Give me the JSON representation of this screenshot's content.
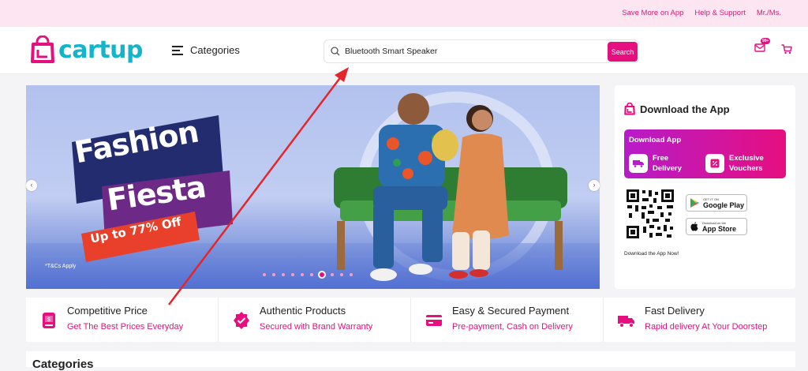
{
  "topbar": {
    "links": [
      "Save More on App",
      "Help & Support",
      "Mr./Ms."
    ]
  },
  "header": {
    "logo_text": "cartup",
    "categories_label": "Categories",
    "search_value": "Bluetooth Smart Speaker",
    "search_button": "Search",
    "messages_badge": "99+"
  },
  "banner": {
    "line1": "Fashion",
    "line2": "Fiesta",
    "offer": "Up to 77% Off",
    "terms": "*T&Cs Apply",
    "slide_count": 10,
    "active_slide": 7
  },
  "app_card": {
    "title": "Download the App",
    "promo_heading": "Download App",
    "feature1_line1": "Free",
    "feature1_line2": "Delivery",
    "feature2_line1": "Exclusive",
    "feature2_line2": "Vouchers",
    "google_small": "GET IT ON",
    "google_big": "Google Play",
    "apple_small": "Download on the",
    "apple_big": "App Store",
    "note": "Download the App Now!"
  },
  "features": [
    {
      "title": "Competitive Price",
      "subtitle": "Get The Best Prices Everyday",
      "icon": "price-tag-icon"
    },
    {
      "title": "Authentic Products",
      "subtitle": "Secured with Brand Warranty",
      "icon": "verified-badge-icon"
    },
    {
      "title": "Easy & Secured Payment",
      "subtitle": "Pre-payment, Cash on Delivery",
      "icon": "credit-card-icon"
    },
    {
      "title": "Fast Delivery",
      "subtitle": "Rapid delivery At Your Doorstep",
      "icon": "delivery-truck-icon"
    }
  ],
  "section": {
    "title": "Categories"
  },
  "colors": {
    "brand_pink": "#e60f7f",
    "brand_teal": "#12b5c9",
    "topbar_bg": "#fde6f1",
    "annotation_red": "#e3262b"
  }
}
